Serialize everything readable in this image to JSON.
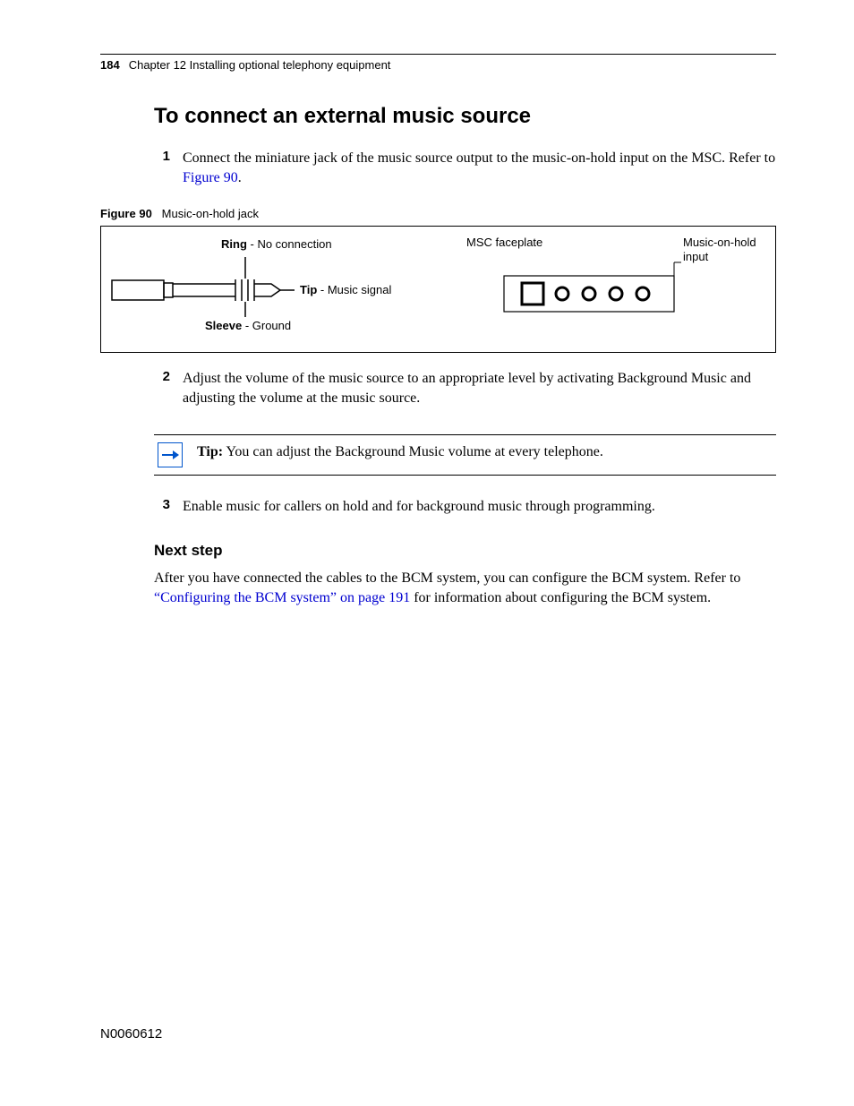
{
  "header": {
    "page_number": "184",
    "chapter_line": "Chapter 12  Installing optional telephony equipment"
  },
  "section_heading": "To connect an external music source",
  "steps": {
    "s1": {
      "num": "1",
      "text_a": "Connect the miniature jack of the music source output to the music-on-hold input on the MSC. Refer to ",
      "xref": "Figure 90",
      "text_b": "."
    },
    "s2": {
      "num": "2",
      "text": "Adjust the volume of the music source to an appropriate level by activating Background Music and adjusting the volume at the music source."
    },
    "s3": {
      "num": "3",
      "text": "Enable music for callers on hold and for background music through programming."
    }
  },
  "figure": {
    "caption_lead": "Figure 90",
    "caption_text": "Music-on-hold jack",
    "labels": {
      "ring_b": "Ring",
      "ring_t": " - No connection",
      "tip_b": "Tip",
      "tip_t": " - Music signal",
      "sleeve_b": "Sleeve",
      "sleeve_t": " - Ground",
      "msc": "MSC faceplate",
      "moh_l1": "Music-on-hold",
      "moh_l2": "input"
    }
  },
  "tip": {
    "lead": "Tip:",
    "text": " You can adjust the Background Music volume at every telephone."
  },
  "next_step": {
    "heading": "Next step",
    "text_a": "After you have connected the cables to the BCM system, you can configure the BCM system. Refer to ",
    "xref": "“Configuring the BCM system” on page 191",
    "text_b": " for information about configuring the BCM system."
  },
  "footer": "N0060612"
}
